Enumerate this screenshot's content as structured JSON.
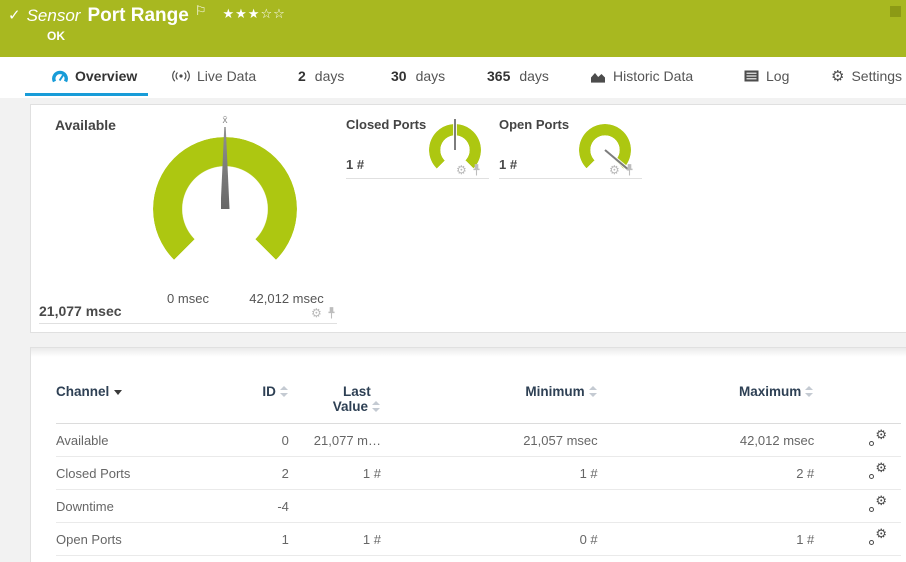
{
  "header": {
    "check_icon": "✓",
    "kind": "Sensor",
    "title": "Port Range",
    "flag_icon": "⚐",
    "stars_filled": "★★★",
    "stars_empty": "☆☆",
    "status": "OK"
  },
  "tabs": {
    "overview": "Overview",
    "live_data": "Live Data",
    "d2_num": "2",
    "d2_label": "days",
    "d30_num": "30",
    "d30_label": "days",
    "d365_num": "365",
    "d365_label": "days",
    "historic": "Historic Data",
    "log": "Log",
    "settings": "Settings"
  },
  "gauges": {
    "available": {
      "title": "Available",
      "value": "21,077 msec",
      "min_label": "0 msec",
      "max_label": "42,012 msec",
      "avg_marker": "x̄",
      "needle_deg": 0
    },
    "closed_ports": {
      "title": "Closed Ports",
      "value": "1 #",
      "needle_deg": 0
    },
    "open_ports": {
      "title": "Open Ports",
      "value": "1 #",
      "needle_deg": 130
    }
  },
  "table": {
    "header": {
      "channel": "Channel",
      "id": "ID",
      "last_line1": "Last",
      "last_line2": "Value",
      "minimum": "Minimum",
      "maximum": "Maximum"
    },
    "rows": [
      {
        "channel": "Available",
        "id": "0",
        "last": "21,077 m…",
        "min": "21,057 msec",
        "max": "42,012 msec"
      },
      {
        "channel": "Closed Ports",
        "id": "2",
        "last": "1 #",
        "min": "1 #",
        "max": "2 #"
      },
      {
        "channel": "Downtime",
        "id": "-4",
        "last": "",
        "min": "",
        "max": ""
      },
      {
        "channel": "Open Ports",
        "id": "1",
        "last": "1 #",
        "min": "0 #",
        "max": "1 #"
      }
    ]
  },
  "colors": {
    "header_green": "#a8b820",
    "gauge_green": "#adc711",
    "accent_blue": "#189cd8",
    "header_text": "#2e4054"
  }
}
